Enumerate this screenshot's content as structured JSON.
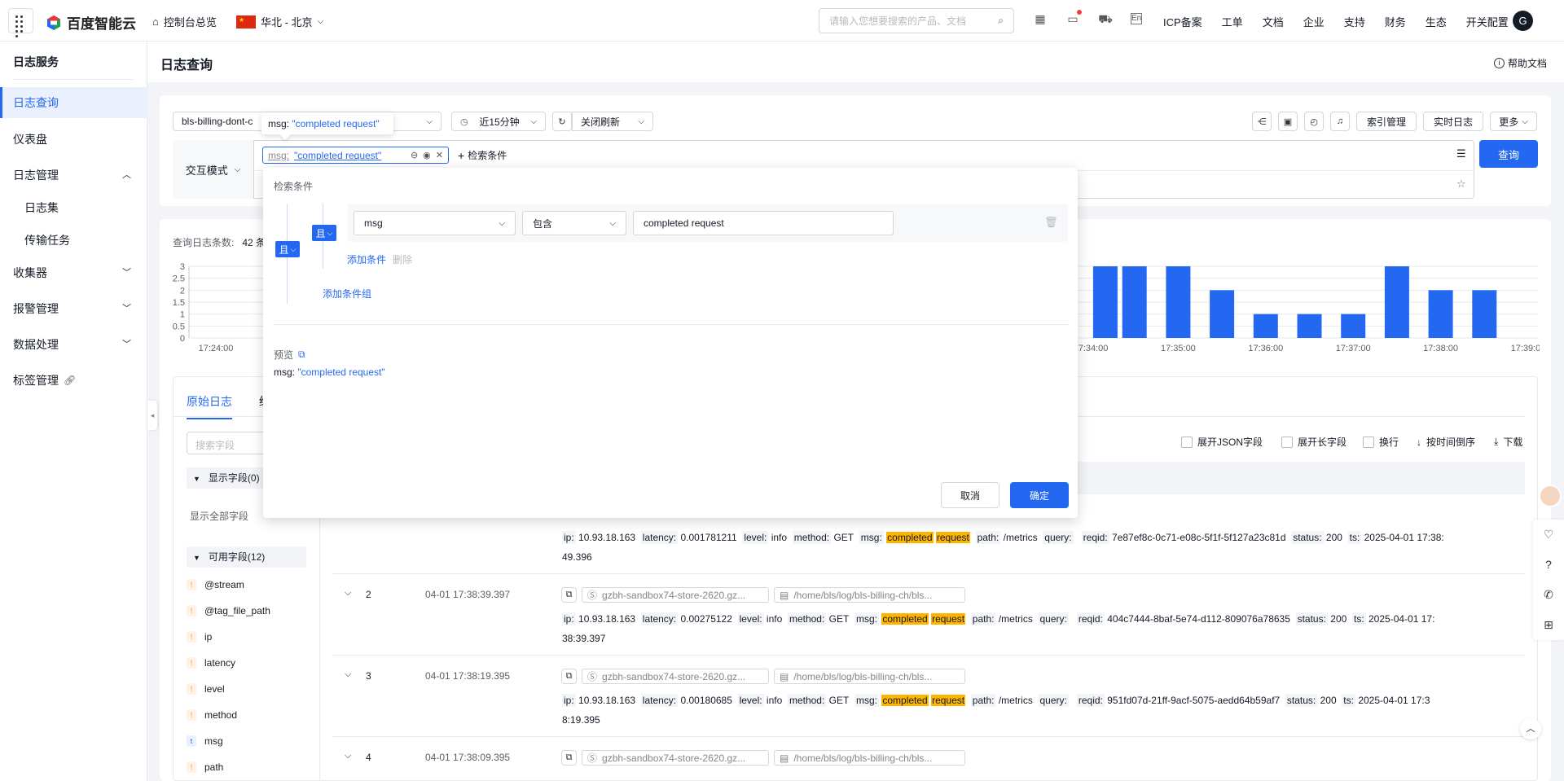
{
  "topbar": {
    "brand": "百度智能云",
    "console_home": "控制台总览",
    "region": "华北 - 北京",
    "search_placeholder": "请输入您想要搜索的产品、文档",
    "links": [
      "ICP备案",
      "工单",
      "文档",
      "企业",
      "支持",
      "财务",
      "生态",
      "开关配置"
    ],
    "avatar_letter": "G"
  },
  "sidebar": {
    "title": "日志服务",
    "items": [
      {
        "label": "日志查询",
        "active": true
      },
      {
        "label": "仪表盘"
      },
      {
        "label": "日志管理",
        "expanded": true
      },
      {
        "label": "日志集",
        "sub": true
      },
      {
        "label": "传输任务",
        "sub": true
      },
      {
        "label": "收集器"
      },
      {
        "label": "报警管理"
      },
      {
        "label": "数据处理"
      },
      {
        "label": "标签管理"
      }
    ]
  },
  "page": {
    "title": "日志查询",
    "help": "帮助文档"
  },
  "toolbar": {
    "logstore": "bls-billing-dont-c",
    "time_range": "近15分钟",
    "refresh": "关闭刷新",
    "index_mgmt": "索引管理",
    "realtime_log": "实时日志",
    "more": "更多",
    "mode": "交互模式",
    "add_condition": "检索条件",
    "query_button": "查询"
  },
  "chip": {
    "key": "msg:",
    "value": "\"completed request\""
  },
  "tooltip": {
    "key": "msg:",
    "value": "\"completed request\""
  },
  "panel": {
    "title": "检索条件",
    "outer_op": "且",
    "inner_op": "且",
    "field": "msg",
    "operator": "包含",
    "value": "completed request",
    "add_condition": "添加条件",
    "delete": "删除",
    "add_group": "添加条件组",
    "preview_label": "预览",
    "preview_key": "msg:",
    "preview_value": "\"completed request\"",
    "cancel": "取消",
    "confirm": "确定"
  },
  "chart": {
    "count_label": "查询日志条数:",
    "count_value": "42 条"
  },
  "chart_data": {
    "type": "bar",
    "title": "",
    "x_ticks": [
      "17:24:00",
      "17:34:00",
      "17:35:00",
      "17:36:00",
      "17:37:00",
      "17:38:00",
      "17:39:00"
    ],
    "y_ticks": [
      "0",
      "0.5",
      "1",
      "1.5",
      "2",
      "2.5",
      "3"
    ],
    "ylim": [
      0,
      3
    ],
    "categories_visible": [
      "17:34:10",
      "17:34:30",
      "17:35:00",
      "17:35:30",
      "17:36:00",
      "17:36:30",
      "17:37:00",
      "17:37:30",
      "17:38:00",
      "17:38:30"
    ],
    "values_visible": [
      3,
      3,
      3,
      2,
      1,
      1,
      1,
      3,
      2,
      2
    ],
    "color": "#2468f2"
  },
  "logs": {
    "tabs": [
      "原始日志",
      "统"
    ],
    "field_search_placeholder": "搜索字段",
    "shown_fields": "显示字段(0)",
    "show_all": "显示全部字段",
    "available_fields": "可用字段(12)",
    "fields": [
      {
        "name": "@stream",
        "type": "!"
      },
      {
        "name": "@tag_file_path",
        "type": "!"
      },
      {
        "name": "ip",
        "type": "!"
      },
      {
        "name": "latency",
        "type": "!"
      },
      {
        "name": "level",
        "type": "!"
      },
      {
        "name": "method",
        "type": "!"
      },
      {
        "name": "msg",
        "type": "t"
      },
      {
        "name": "path",
        "type": "!"
      }
    ],
    "options": [
      "展开JSON字段",
      "展开长字段",
      "换行",
      "按时间倒序",
      "下载"
    ],
    "rows": [
      {
        "idx": "",
        "time": "",
        "host": "",
        "file": "",
        "latency": "0.001781211",
        "reqid": "7e87ef8c-0c71-e08c-5f1f-5f127a23c81d",
        "ts": "2025-04-01 17:38:",
        "ts_tail": "49.396"
      },
      {
        "idx": "2",
        "time": "04-01 17:38:39.397",
        "host": "gzbh-sandbox74-store-2620.gz...",
        "file": "/home/bls/log/bls-billing-ch/bls...",
        "latency": "0.00275122",
        "reqid": "404c7444-8baf-5e74-d112-809076a78635",
        "ts": "2025-04-01 17:",
        "ts_tail": "38:39.397"
      },
      {
        "idx": "3",
        "time": "04-01 17:38:19.395",
        "host": "gzbh-sandbox74-store-2620.gz...",
        "file": "/home/bls/log/bls-billing-ch/bls...",
        "latency": "0.00180685",
        "reqid": "951fd07d-21ff-9acf-5075-aedd64b59af7",
        "ts": "2025-04-01 17:3",
        "ts_tail": "8:19.395"
      },
      {
        "idx": "4",
        "time": "04-01 17:38:09.395",
        "host": "gzbh-sandbox74-store-2620.gz...",
        "file": "/home/bls/log/bls-billing-ch/bls...",
        "latency": "",
        "reqid": "",
        "ts": "",
        "ts_tail": ""
      }
    ],
    "kv": {
      "ip": "10.93.18.163",
      "level": "info",
      "method": "GET",
      "path": "/metrics",
      "status": "200",
      "msg_word1": "completed",
      "msg_word2": "request"
    }
  }
}
